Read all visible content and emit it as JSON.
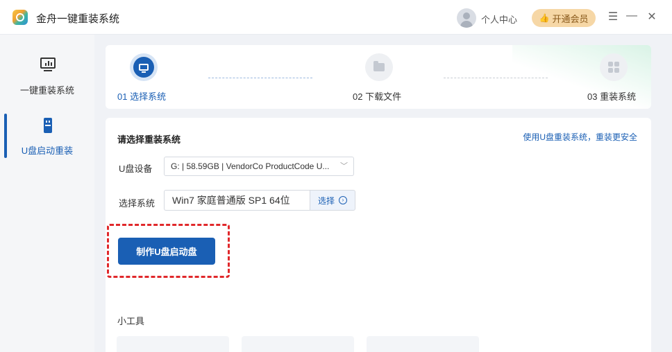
{
  "app": {
    "title": "金舟一键重装系统"
  },
  "header": {
    "user_center": "个人中心",
    "vip_label": "开通会员",
    "menu_glyph": "☰",
    "minimize_glyph": "—",
    "close_glyph": "✕"
  },
  "sidebar": {
    "items": [
      {
        "label": "一键重装系统",
        "icon": "monitor-icon",
        "active": false
      },
      {
        "label": "U盘启动重装",
        "icon": "usb-drive-icon",
        "active": true
      }
    ]
  },
  "steps": [
    {
      "label": "01 选择系统",
      "icon": "monitor-icon",
      "state": "active"
    },
    {
      "label": "02 下载文件",
      "icon": "folder-icon",
      "state": "pending"
    },
    {
      "label": "03 重装系统",
      "icon": "windows-grid-icon",
      "state": "pending"
    }
  ],
  "main": {
    "section_title": "请选择重装系统",
    "help_link": "使用U盘重装系统，重装更安全",
    "usb_label": "U盘设备",
    "usb_value": "G: | 58.59GB | VendorCo ProductCode U...",
    "system_label": "选择系统",
    "system_value": "Win7 家庭普通版 SP1 64位",
    "choose_label": "选择",
    "make_button": "制作U盘启动盘",
    "tools_title": "小工具"
  },
  "colors": {
    "accent": "#1a5fb4",
    "highlight_frame": "#e0282b",
    "vip_bg": "#f6d7a6"
  }
}
